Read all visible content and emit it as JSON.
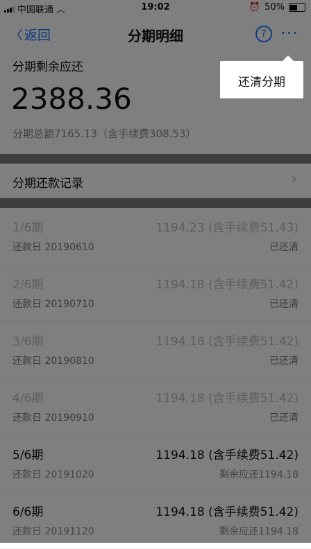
{
  "status_bar": {
    "carrier": "中国联通",
    "time": "19:02",
    "battery": "50%"
  },
  "nav": {
    "back_label": "返回",
    "title": "分期明细",
    "help_label": "?",
    "more_label": "···"
  },
  "summary": {
    "label": "分期剩余应还",
    "amount": "2388.36",
    "total": "分期总额7165.13（含手续费308.53）"
  },
  "records": {
    "label": "分期还款记录"
  },
  "installments": [
    {
      "period": "1/6期",
      "amount": "1194.23 (含手续费51.43)",
      "date": "还款日 20190610",
      "status": "已还清"
    },
    {
      "period": "2/6期",
      "amount": "1194.18 (含手续费51.42)",
      "date": "还款日 20190710",
      "status": "已还清"
    },
    {
      "period": "3/6期",
      "amount": "1194.18 (含手续费51.42)",
      "date": "还款日 20190810",
      "status": "已还清"
    },
    {
      "period": "4/6期",
      "amount": "1194.18 (含手续费51.42)",
      "date": "还款日 20190910",
      "status": "已还清"
    },
    {
      "period": "5/6期",
      "amount": "1194.18 (含手续费51.42)",
      "date": "还款日 20191020",
      "status": "剩余应还1194.18"
    },
    {
      "period": "6/6期",
      "amount": "1194.18 (含手续费51.42)",
      "date": "还款日 20191120",
      "status": "剩余应还1194.18"
    }
  ],
  "popover": {
    "item_label": "还清分期"
  },
  "colors": {
    "accent": "#1677ff",
    "overlay": "rgba(0,0,0,0.5)"
  }
}
